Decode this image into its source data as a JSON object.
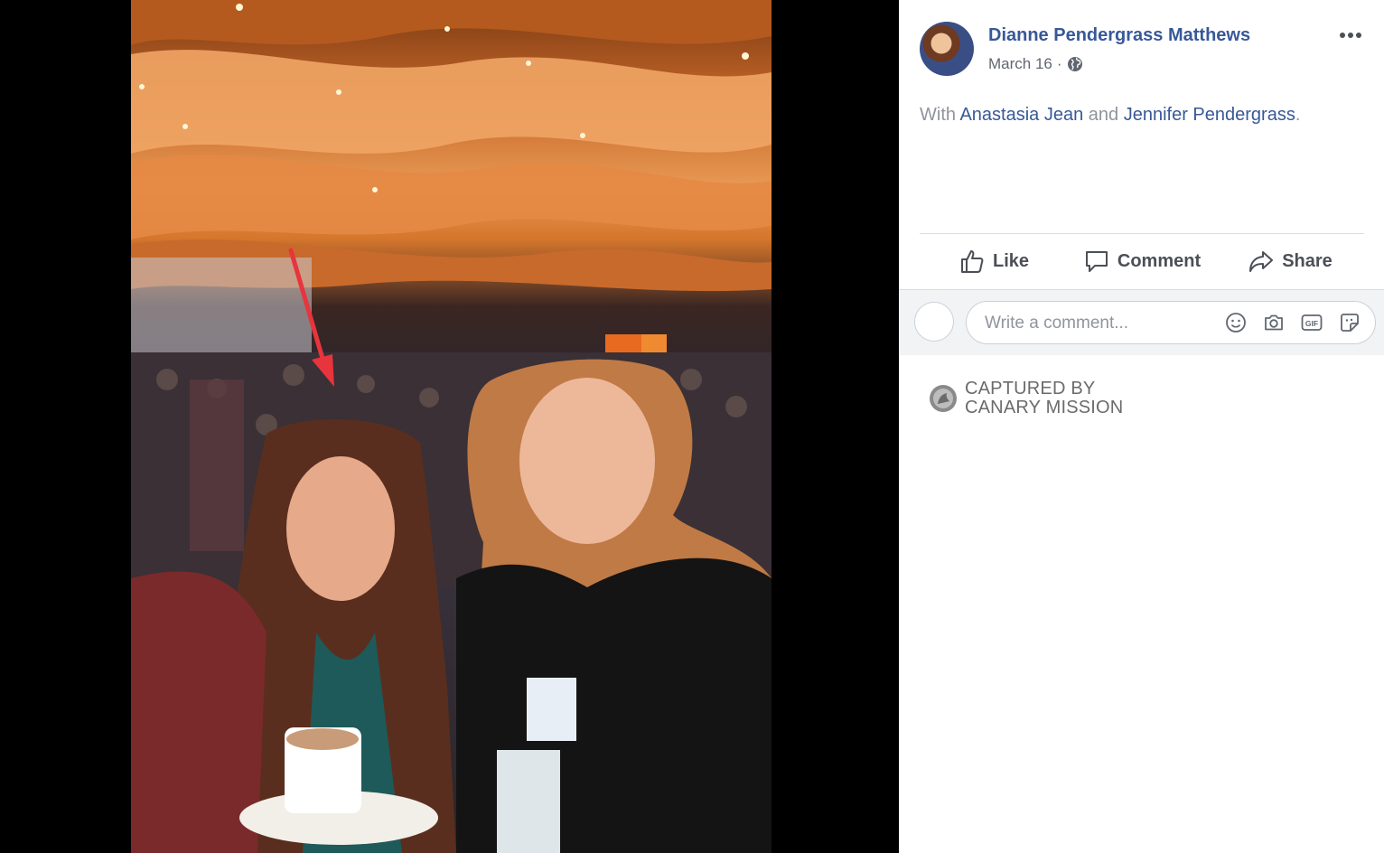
{
  "post": {
    "author": "Dianne Pendergrass Matthews",
    "date": "March 16",
    "separator": "·",
    "privacy_icon": "globe-icon",
    "with_prefix": "With",
    "tagged": [
      "Anastasia Jean",
      "Jennifer Pendergrass"
    ],
    "with_and": "and",
    "with_end": "."
  },
  "actions": {
    "like": "Like",
    "comment": "Comment",
    "share": "Share"
  },
  "comment_box": {
    "placeholder": "Write a comment...",
    "icons": [
      "emoji-icon",
      "camera-icon",
      "gif-icon",
      "sticker-icon"
    ],
    "gif_label": "GIF"
  },
  "watermark": {
    "line1": "CAPTURED BY",
    "line2": "CANARY MISSION"
  },
  "colors": {
    "link": "#385898",
    "secondary_text": "#90949c",
    "annotation_arrow": "#e8343c"
  }
}
